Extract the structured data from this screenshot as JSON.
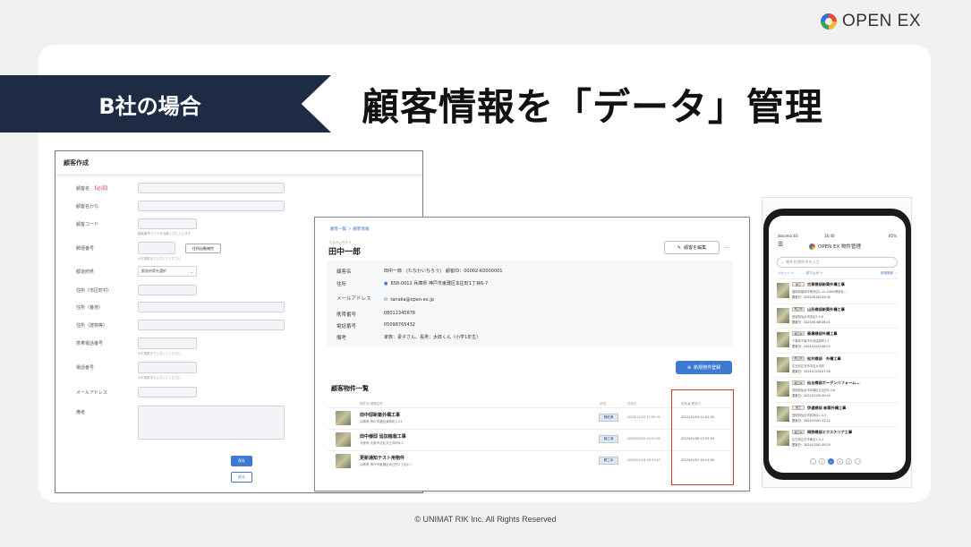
{
  "brand": {
    "name": "OPEN EX"
  },
  "slide": {
    "badge": "B社の場合",
    "title": "顧客情報を「データ」管理",
    "footer": "© UNIMAT RIK Inc. All Rights Reserved"
  },
  "form": {
    "title": "顧客作成",
    "required_mark": "【必須】",
    "labels": [
      "顧客名",
      "顧客名かな",
      "顧客コード",
      "郵便番号",
      "都道府県",
      "住所（市区町村）",
      "住所（番地）",
      "住所（建物等）",
      "携帯電話番号",
      "電話番号",
      "メールアドレス",
      "備考"
    ],
    "hint_code": "顧客番号コードを自動入力しています",
    "hint_phone": "※半角数字で入力してください",
    "zip_button": "住所自動補完",
    "prefecture_placeholder": "都道府県を選択",
    "save": "保存",
    "back": "戻る"
  },
  "detail": {
    "breadcrumb": "顧客一覧 ＞ 顧客情報",
    "kana": "たなかいちろう",
    "name": "田中一郎",
    "edit_button": "顧客を編集",
    "more": "…",
    "info": [
      {
        "label": "顧客名",
        "value": "田中一郎　(たなかいちろう)　顧客ID：00002-K0000001"
      },
      {
        "label": "住所",
        "value": "658-0012 兵庫県 神戸市東灘区本庄町1丁目6-7"
      },
      {
        "label": "メールアドレス",
        "value": "tanaka@open-ex.jp"
      },
      {
        "label": "携帯番号",
        "value": "08012345678"
      },
      {
        "label": "電話番号",
        "value": "05098765432"
      },
      {
        "label": "備考",
        "value": "家族：妻子さん、長男：太郎くん（小学1年生）"
      }
    ],
    "new_button": "新規物件登録",
    "list_title": "顧客物件一覧",
    "headers": [
      "物件名/現場住所",
      "状況",
      "作成日",
      "更新者/更新日"
    ],
    "rows": [
      {
        "name": "田中邸新築外構工事",
        "addr": "兵庫県 神戸市灘区篠原町2-24",
        "status": "契約済",
        "created": "2023/12/25 17:35:31",
        "updated": "2024/12/04 11:02:35"
      },
      {
        "name": "田中様邸 追加植栽工事",
        "addr": "大阪府 大阪市北区天王寺町8-1",
        "status": "施工済",
        "created": "2024/05/02 10:41:52",
        "updated": "2025/01/06 13:33:29"
      },
      {
        "name": "更新通知テスト用物件",
        "addr": "兵庫県 神戸市東灘区本庄町2丁目6-7",
        "status": "着工中",
        "created": "2024/07/24 18:37:47",
        "updated": "2025/01/07 14:14:35"
      }
    ]
  },
  "mobile": {
    "status_left": "docomo 4G",
    "status_time": "16:40",
    "status_right": "85%",
    "app_title": "OPEN EX 物件管理",
    "search_placeholder": "物件名/物件名を入力",
    "reset": "リセット",
    "filter": "絞り込み",
    "sort": "新規登録",
    "items": [
      {
        "status": "施工",
        "name": "古賀様邸新築外構工事",
        "addr": "福岡県福岡市博多区1-15-20NM博多前…",
        "updated": "更新日：2025/01/05 05:34"
      },
      {
        "status": "施工中",
        "name": "山形様邸新築外構工事",
        "addr": "宮城県仙台市泉区2-4-6",
        "updated": "更新日：2025/01/06 06:21"
      },
      {
        "status": "施工中",
        "name": "高橋様邸外構工事",
        "addr": "千葉県千葉市中央区新町1-1",
        "updated": "更新日：2024/12/24 08:25"
      },
      {
        "status": "施工中",
        "name": "松井様邸　外構工事",
        "addr": "広島県広島市中区大手町",
        "updated": "更新日：2024/12/24 07:28"
      },
      {
        "status": "施工中",
        "name": "仙台様邸ガーデンリフォーム…",
        "addr": "宮城県仙台市青葉区五反田4-5-6",
        "updated": "更新日：2024/12/20 00:54"
      },
      {
        "status": "施工",
        "name": "伊達様邸 新築外構工事",
        "addr": "宮城県仙台市若林区2-4-5",
        "updated": "更新日：2024/12/03 23:12"
      },
      {
        "status": "施工中",
        "name": "岡野様邸エクステリア工事",
        "addr": "広島県広島市東区5-5-4",
        "updated": "更新日：2024/12/02 00:29"
      }
    ],
    "pages": [
      "‹",
      "1",
      "2",
      "3",
      "4",
      "›"
    ]
  }
}
